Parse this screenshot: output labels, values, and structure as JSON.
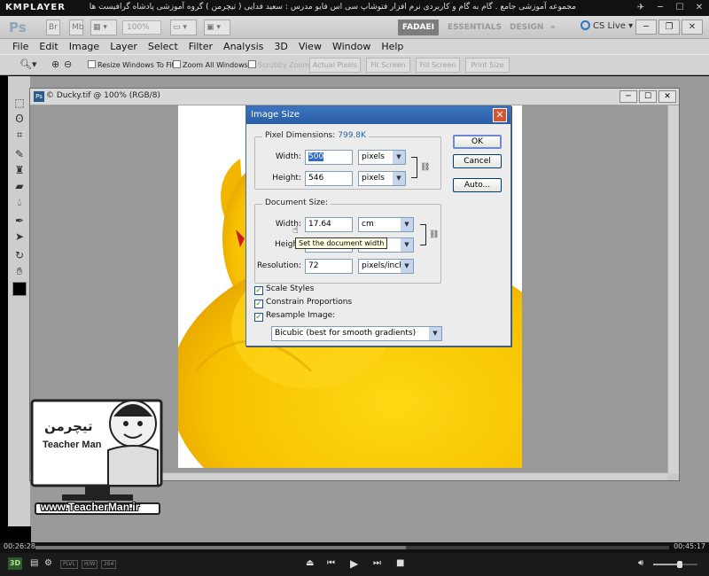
{
  "player": {
    "logo": "KMPLAYER",
    "video_title": "مجموعه آموزشی جامع . گام به گام و کاربردی نرم افزار فتوشاپ سی اس فایو  مدرس : سعید فدایی ( تیچرمن ) گروه آموزشی پادشاه گرافیست ها",
    "elapsed": "00:26:28",
    "total": "00:45:17",
    "progress": 0.584,
    "volume": 0.6,
    "badge_3d": "3D",
    "mode_tags": [
      "PLVL",
      "H/W",
      "264"
    ]
  },
  "photoshop": {
    "app_logo": "Ps",
    "zoom": "100%",
    "workspaces": [
      "FADAEI",
      "ESSENTIALS",
      "DESIGN"
    ],
    "active_workspace": "FADAEI",
    "cs_live": "CS Live",
    "menu": [
      "File",
      "Edit",
      "Image",
      "Layer",
      "Select",
      "Filter",
      "Analysis",
      "3D",
      "View",
      "Window",
      "Help"
    ],
    "options": {
      "resize_windows": "Resize Windows To Fit",
      "zoom_all": "Zoom All Windows",
      "scrubby_zoom": "Scrubby Zoom",
      "actual_pixels": "Actual Pixels",
      "fit_screen": "Fit Screen",
      "fill_screen": "Fill Screen",
      "print_size": "Print Size"
    },
    "document": {
      "title": "Ducky.tif @ 100% (RGB/8)"
    }
  },
  "dialog": {
    "title": "Image Size",
    "pixel_dimensions_label": "Pixel Dimensions:",
    "pixel_dimensions_value": "799.8K",
    "width_label": "Width:",
    "width_px": "500",
    "height_label": "Height:",
    "height_px": "546",
    "px_unit": "pixels",
    "document_size_label": "Document Size:",
    "doc_width": "17.64",
    "doc_width_unit": "cm",
    "doc_height_label": "Heigh",
    "resolution_label": "Resolution:",
    "resolution": "72",
    "resolution_unit": "pixels/inch",
    "ok": "OK",
    "cancel": "Cancel",
    "auto": "Auto...",
    "scale_styles": "Scale Styles",
    "constrain": "Constrain Proportions",
    "resample": "Resample Image:",
    "resample_method": "Bicubic (best for smooth gradients)",
    "tooltip": "Set the document width"
  },
  "watermark": {
    "url": "www.TeacherMan.ir",
    "brand": "Teacher Man",
    "brand_fa": "تیچرمن"
  },
  "colors": {
    "accent": "#2a5fa6",
    "duck": "#f6c800",
    "duck_shadow": "#e3a400",
    "close_red": "#d9532e"
  }
}
